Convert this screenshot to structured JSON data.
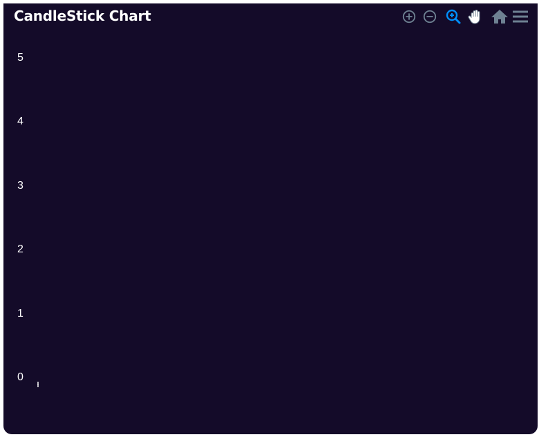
{
  "chart_data": {
    "type": "candlestick",
    "title": "CandleStick Chart",
    "xlabel": "",
    "ylabel": "",
    "ylim": [
      0,
      5
    ],
    "y_ticks": [
      "0",
      "1",
      "2",
      "3",
      "4",
      "5"
    ],
    "categories": [
      ""
    ],
    "series": [
      {
        "open": [
          0
        ],
        "high": [
          0
        ],
        "low": [
          0
        ],
        "close": [
          0
        ]
      }
    ],
    "grid": false
  },
  "toolbar": {
    "icons": [
      "zoom-in-icon",
      "zoom-out-icon",
      "selection-zoom-icon",
      "pan-icon",
      "home-icon",
      "menu-icon"
    ],
    "active_color": "#008ffb",
    "inactive_color": "#6e8192"
  },
  "colors": {
    "background": "#140b29",
    "text": "#ffffff",
    "candle": "#ffffff"
  }
}
